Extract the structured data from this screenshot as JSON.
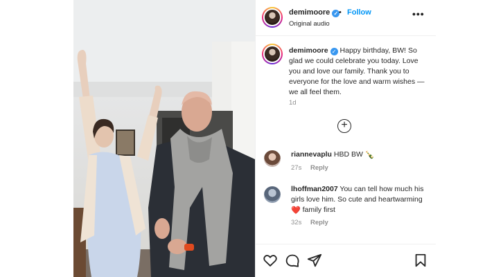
{
  "header": {
    "username": "demimoore",
    "separator": "•",
    "follow_label": "Follow",
    "audio_label": "Original audio",
    "more_label": "•••"
  },
  "caption": {
    "username": "demimoore",
    "text": "Happy birthday, BW! So glad we could celebrate you today. Love you and love our family. Thank you to everyone for the love and warm wishes — we all feel them.",
    "time": "1d"
  },
  "load_more_label": "+",
  "comments": [
    {
      "username": "riannevaplu",
      "text": "HBD BW",
      "emoji": "🍾",
      "time": "27s",
      "reply_label": "Reply"
    },
    {
      "username": "lhoffman2007",
      "text": "You can tell how much his girls love him. So cute and heartwarming",
      "emoji": "❤️",
      "text_after": "family first",
      "time": "32s",
      "reply_label": "Reply"
    }
  ],
  "icons": [
    "heart-icon",
    "comment-icon",
    "share-icon",
    "bookmark-icon",
    "verified-badge-icon",
    "add-circle-icon",
    "more-options-icon"
  ],
  "colors": {
    "follow": "#0095f6",
    "verified": "#3897f0",
    "meta": "#8e8e8e",
    "text": "#262626"
  }
}
